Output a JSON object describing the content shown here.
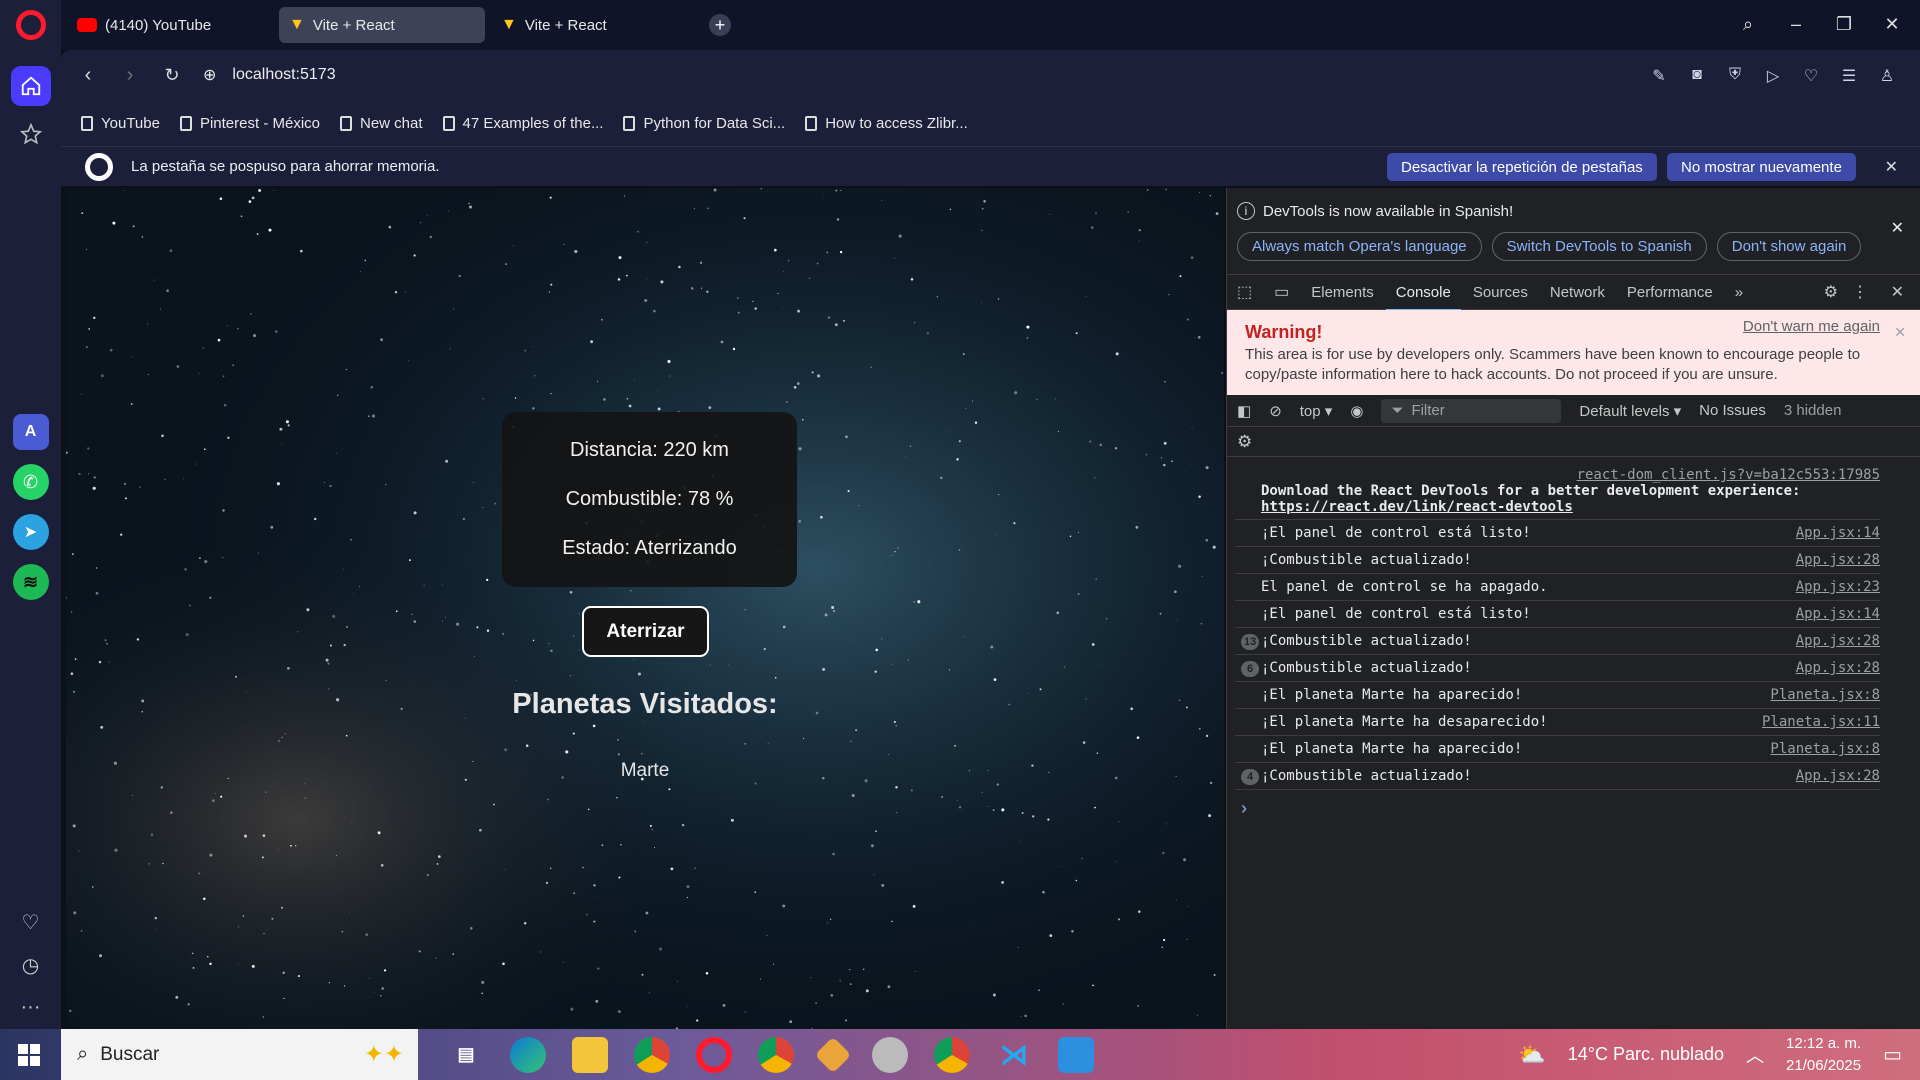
{
  "browser": {
    "tabs": [
      {
        "label": "(4140) YouTube",
        "icon": "youtube-icon",
        "active": false
      },
      {
        "label": "Vite + React",
        "icon": "vite-icon",
        "active": true
      },
      {
        "label": "Vite + React",
        "icon": "vite-icon",
        "active": false
      }
    ],
    "new_tab": "+",
    "url": "localhost:5173",
    "bookmarks": [
      "YouTube",
      "Pinterest - México",
      "New chat",
      "47 Examples of the...",
      "Python for Data Sci...",
      "How to access Zlibr..."
    ],
    "infobar": {
      "message": "La pestaña se pospuso para ahorrar memoria.",
      "button1": "Desactivar la repetición de pestañas",
      "button2": "No mostrar nuevamente"
    }
  },
  "app": {
    "distance": "Distancia: 220 km",
    "fuel": "Combustible: 78 %",
    "status": "Estado: Aterrizando",
    "land_button": "Aterrizar",
    "visited_title": "Planetas Visitados:",
    "planet": "Marte"
  },
  "devtools": {
    "notice": "DevTools is now available in Spanish!",
    "notice_buttons": [
      "Always match Opera's language",
      "Switch DevTools to Spanish",
      "Don't show again"
    ],
    "tabs": [
      "Elements",
      "Console",
      "Sources",
      "Network",
      "Performance"
    ],
    "active_tab": "Console",
    "warning_title": "Warning!",
    "warning_text": "This area is for use by developers only. Scammers have been known to encourage people to copy/paste information here to hack accounts. Do not proceed if you are unsure.",
    "warning_dismiss": "Don't warn me again",
    "context": "top",
    "filter_placeholder": "Filter",
    "levels": "Default levels",
    "issues": "No Issues",
    "hidden": "3 hidden",
    "first_log": {
      "src": "react-dom_client.js?v=ba12c553:17985",
      "line1": "Download the React DevTools for a better development experience:",
      "link": "https://react.dev/link/react-devtools"
    },
    "logs": [
      {
        "count": "",
        "text": "¡El panel de control está listo!",
        "src": "App.jsx:14"
      },
      {
        "count": "",
        "text": "¡Combustible actualizado!",
        "src": "App.jsx:28"
      },
      {
        "count": "",
        "text": "El panel de control se ha apagado.",
        "src": "App.jsx:23"
      },
      {
        "count": "",
        "text": "¡El panel de control está listo!",
        "src": "App.jsx:14"
      },
      {
        "count": "13",
        "text": "¡Combustible actualizado!",
        "src": "App.jsx:28"
      },
      {
        "count": "6",
        "text": "¡Combustible actualizado!",
        "src": "App.jsx:28"
      },
      {
        "count": "",
        "text": "¡El planeta Marte ha aparecido!",
        "src": "Planeta.jsx:8"
      },
      {
        "count": "",
        "text": "¡El planeta Marte ha desaparecido!",
        "src": "Planeta.jsx:11"
      },
      {
        "count": "",
        "text": "¡El planeta Marte ha aparecido!",
        "src": "Planeta.jsx:8"
      },
      {
        "count": "4",
        "text": "¡Combustible actualizado!",
        "src": "App.jsx:28"
      }
    ],
    "prompt": "›"
  },
  "taskbar": {
    "search_placeholder": "Buscar",
    "weather": "14°C  Parc. nublado",
    "time": "12:12 a. m.",
    "date": "21/06/2025"
  },
  "colors": {
    "accent": "#4b3bff",
    "warning_bg": "#fde7e9",
    "warning_title": "#c5221f",
    "link": "#8ab4f8"
  }
}
